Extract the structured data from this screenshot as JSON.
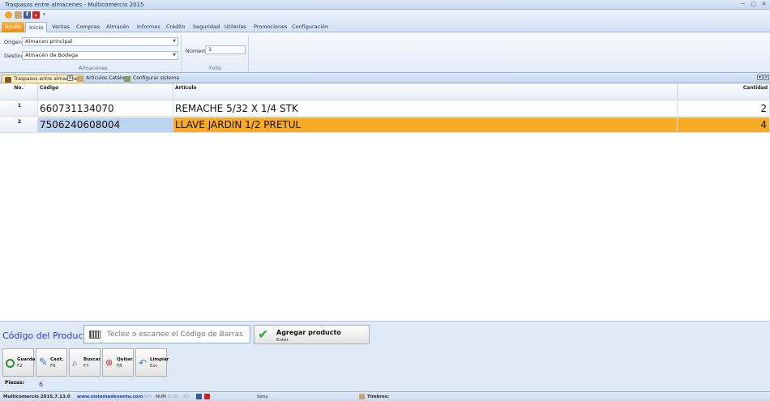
{
  "window": {
    "title": "Traspasos entre almacenes - Multicomercio 2015"
  },
  "ribbon_tabs": [
    "Ayuda",
    "Inicio",
    "Ventas",
    "Compras",
    "Almacén",
    "Informes",
    "Crédito",
    "Seguridad",
    "Utilerías",
    "Promociones",
    "Configuración"
  ],
  "almacenes": {
    "origen_label": "Origen:",
    "origen_value": "Almacen principal",
    "destino_label": "Destino:",
    "destino_value": "Almacén de Bodega",
    "group_caption": "Almacenes"
  },
  "folio": {
    "numero_label": "Número:",
    "numero_value": "1",
    "group_caption": "Folio"
  },
  "doc_tabs": [
    "Traspasos entre almacenes",
    "Artículos Catálogo",
    "Configurar sistema"
  ],
  "grid": {
    "headers": {
      "no": "No.",
      "codigo": "Código",
      "articulo": "Artículo",
      "cantidad": "Cantidad"
    },
    "rows": [
      {
        "no": "1",
        "codigo": "660731134070",
        "articulo": "REMACHE 5/32 X 1/4 STK",
        "cantidad": "2"
      },
      {
        "no": "2",
        "codigo": "7506240608004",
        "articulo": "LLAVE JARDIN 1/2 PRETUL",
        "cantidad": "4"
      }
    ]
  },
  "entry": {
    "label": "Código del Producto:",
    "placeholder": "Teclee o escanee el Código de Barras",
    "add_label": "Agregar producto",
    "add_key": "Enter"
  },
  "actions": [
    {
      "name": "Guarda",
      "key": "F2"
    },
    {
      "name": "Cant.",
      "key": "F6"
    },
    {
      "name": "Buscar",
      "key": "F7"
    },
    {
      "name": "Quitar",
      "key": "F8"
    },
    {
      "name": "Limpiar",
      "key": "Esc"
    }
  ],
  "pieces": {
    "label": "Piezas:",
    "value": "6"
  },
  "status": {
    "version": "Multicomercio 2015.7.13.0",
    "website": "www.sistemadeventa.com",
    "caps": "CAPS",
    "num": "NUM",
    "scrl": "SCRL",
    "ins": "INS",
    "user": "Sony",
    "timbres": "Timbres:"
  },
  "colors": {
    "selected_row": "#f9ab28",
    "selected_code_cell": "#bcd4ef",
    "accent_blue": "#2a3bd3"
  }
}
